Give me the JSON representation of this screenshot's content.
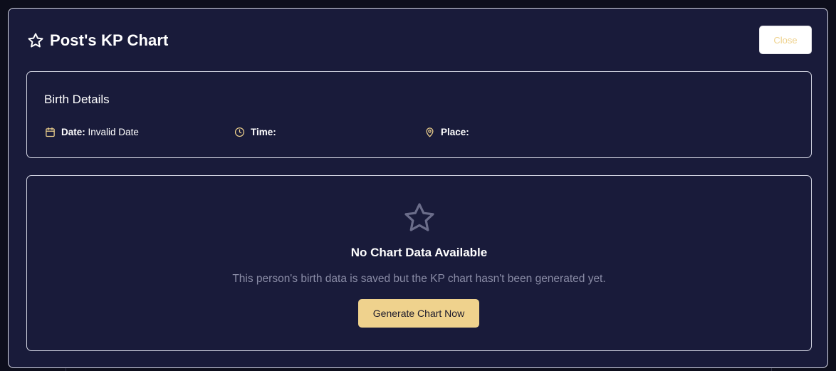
{
  "modal": {
    "title": "Post's KP Chart",
    "close_label": "Close",
    "title_icon": "star-icon"
  },
  "birth_details": {
    "heading": "Birth Details",
    "date": {
      "icon": "calendar-icon",
      "label": "Date:",
      "value": "Invalid Date"
    },
    "time": {
      "icon": "clock-icon",
      "label": "Time:",
      "value": ""
    },
    "place": {
      "icon": "map-pin-icon",
      "label": "Place:",
      "value": ""
    }
  },
  "empty_state": {
    "icon": "star-icon",
    "title": "No Chart Data Available",
    "description": "This person's birth data is saved but the KP chart hasn't been generated yet.",
    "button_label": "Generate Chart Now"
  },
  "colors": {
    "background": "#0d0e1c",
    "modal_bg": "#191b3a",
    "accent": "#efd28d",
    "muted_text": "#8a8ca6",
    "border": "#d4d6e4"
  }
}
